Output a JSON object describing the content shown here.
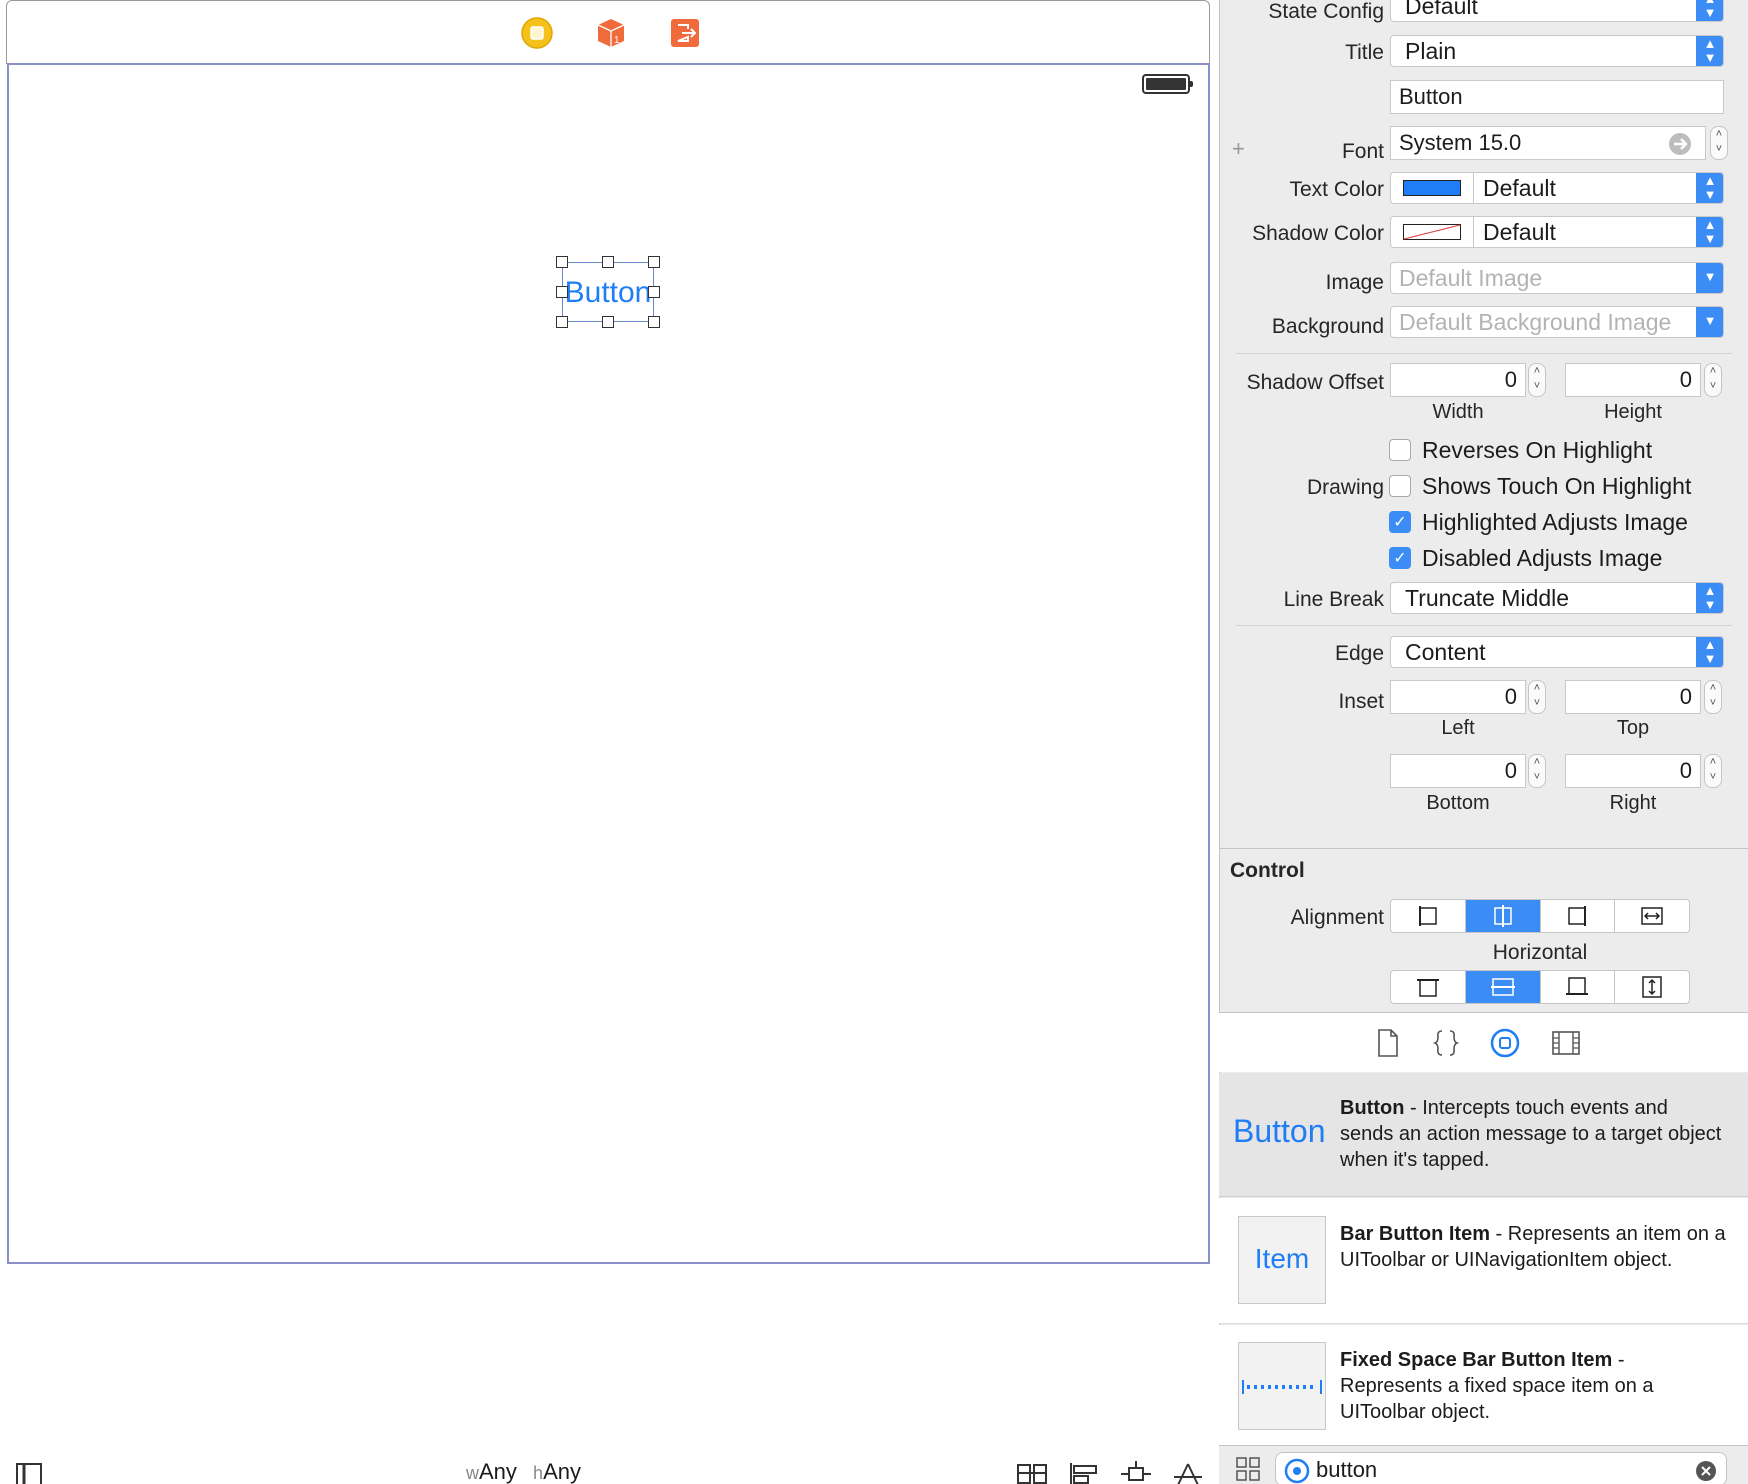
{
  "canvas": {
    "button_label": "Button",
    "size_class": {
      "w_prefix": "w",
      "w_value": "Any",
      "h_prefix": "h",
      "h_value": "Any"
    }
  },
  "attributes": {
    "state_config": {
      "label": "State Config",
      "value": "Default"
    },
    "title": {
      "label": "Title",
      "value": "Plain",
      "text": "Button"
    },
    "font": {
      "label": "Font",
      "value": "System 15.0",
      "plus": "+"
    },
    "text_color": {
      "label": "Text Color",
      "value": "Default",
      "swatch": "#1f7ef5"
    },
    "shadow_color": {
      "label": "Shadow Color",
      "value": "Default"
    },
    "image": {
      "label": "Image",
      "placeholder": "Default Image"
    },
    "background": {
      "label": "Background",
      "placeholder": "Default Background Image"
    },
    "shadow_offset": {
      "label": "Shadow Offset",
      "width": "0",
      "height": "0",
      "width_label": "Width",
      "height_label": "Height"
    },
    "drawing": {
      "label": "Drawing",
      "options": [
        {
          "label": "Reverses On Highlight",
          "checked": false
        },
        {
          "label": "Shows Touch On Highlight",
          "checked": false
        },
        {
          "label": "Highlighted Adjusts Image",
          "checked": true
        },
        {
          "label": "Disabled Adjusts Image",
          "checked": true
        }
      ]
    },
    "line_break": {
      "label": "Line Break",
      "value": "Truncate Middle"
    },
    "edge": {
      "label": "Edge",
      "value": "Content"
    },
    "inset": {
      "label": "Inset",
      "left": "0",
      "top": "0",
      "bottom": "0",
      "right": "0",
      "left_label": "Left",
      "top_label": "Top",
      "bottom_label": "Bottom",
      "right_label": "Right"
    }
  },
  "control": {
    "section_title": "Control",
    "alignment_label": "Alignment",
    "horizontal_label": "Horizontal",
    "horizontal_selected": 1,
    "vertical_selected": 1
  },
  "library": {
    "items": [
      {
        "thumb_text": "Button",
        "name": "Button",
        "description": " - Intercepts touch events and sends an action message to a target object when it's tapped."
      },
      {
        "thumb_text": "Item",
        "name": "Bar Button Item",
        "description": " - Represents an item on a UIToolbar or UINavigationItem object."
      },
      {
        "thumb_text": "",
        "name": "Fixed Space Bar Button Item",
        "description": " - Represents a fixed space item on a UIToolbar object."
      }
    ],
    "search_value": "button"
  },
  "colors": {
    "accent": "#3b8df5",
    "selection_border": "#8a8fc9",
    "button_text": "#1f7ef5"
  }
}
